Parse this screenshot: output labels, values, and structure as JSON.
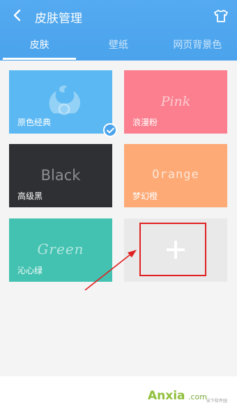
{
  "header": {
    "title": "皮肤管理",
    "back_icon": "chevron-left-icon",
    "action_icon": "tshirt-icon"
  },
  "tabs": [
    {
      "label": "皮肤",
      "active": true
    },
    {
      "label": "壁纸",
      "active": false
    },
    {
      "label": "网页背景色",
      "active": false
    }
  ],
  "skins": [
    {
      "label": "原色经典",
      "word": "",
      "selected": true,
      "color": "#5bb8f2"
    },
    {
      "label": "浪漫粉",
      "word": "Pink",
      "selected": false,
      "color": "#fb7f8e"
    },
    {
      "label": "高级黑",
      "word": "Black",
      "selected": false,
      "color": "#2f3034"
    },
    {
      "label": "梦幻橙",
      "word": "Orange",
      "selected": false,
      "color": "#fdaa76"
    },
    {
      "label": "沁心绿",
      "word": "Green",
      "selected": false,
      "color": "#43c2b1"
    }
  ],
  "add_tile": {
    "icon": "plus-icon"
  },
  "colors": {
    "accent": "#4aa3ec",
    "highlight": "#e02020"
  },
  "watermark": {
    "brand": "Anxia",
    "domain": ".com",
    "tagline": "安下软件园"
  }
}
